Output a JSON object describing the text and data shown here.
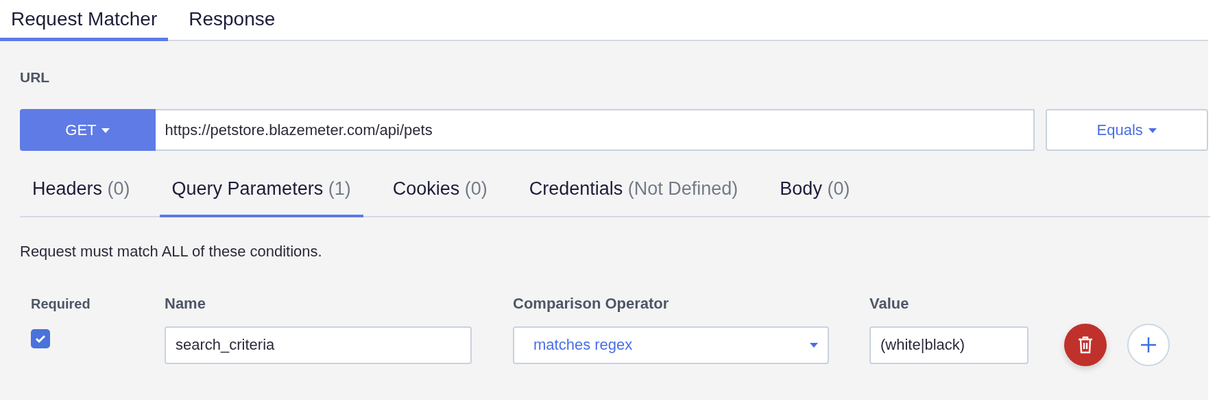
{
  "tabs": [
    {
      "label": "Request Matcher",
      "selected": true
    },
    {
      "label": "Response",
      "selected": false
    }
  ],
  "url": {
    "label": "URL",
    "method": "GET",
    "value": "https://petstore.blazemeter.com/api/pets",
    "match": "Equals"
  },
  "sections": [
    {
      "label": "Headers",
      "count": "(0)",
      "selected": false
    },
    {
      "label": "Query Parameters",
      "count": "(1)",
      "selected": true
    },
    {
      "label": "Cookies",
      "count": "(0)",
      "selected": false
    },
    {
      "label": "Credentials",
      "count": "(Not Defined)",
      "selected": false
    },
    {
      "label": "Body",
      "count": "(0)",
      "selected": false
    }
  ],
  "conditions_note": "Request must match ALL of these conditions.",
  "table": {
    "columns": [
      "Required",
      "Name",
      "Comparison Operator",
      "Value"
    ],
    "rows": [
      {
        "required": true,
        "name": "search_criteria",
        "operator": "matches regex",
        "value": "(white|black)"
      }
    ]
  }
}
